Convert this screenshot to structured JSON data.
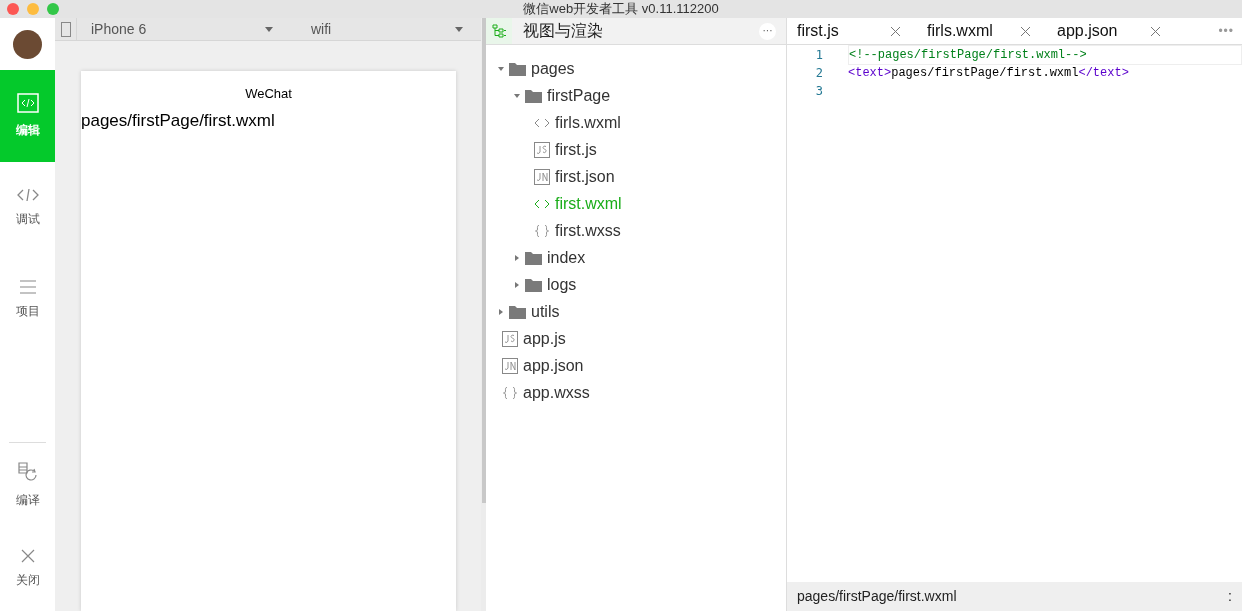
{
  "window": {
    "title": "微信web开发者工具 v0.11.112200"
  },
  "sidebar": {
    "items": [
      {
        "kind": "edit",
        "label": "编辑",
        "selected": true
      },
      {
        "kind": "debug",
        "label": "调试",
        "selected": false
      },
      {
        "kind": "project",
        "label": "项目",
        "selected": false
      }
    ],
    "bottom_items": [
      {
        "kind": "compile",
        "label": "编译"
      },
      {
        "kind": "close",
        "label": "关闭"
      }
    ]
  },
  "simulator": {
    "device": "iPhone 6",
    "network": "wifi",
    "nav_title": "WeChat",
    "page_text": "pages/firstPage/first.wxml"
  },
  "file_tree": {
    "title": "视图与渲染",
    "more": "···",
    "items": [
      {
        "kind": "folder",
        "name": "pages",
        "expanded": true,
        "children": [
          {
            "kind": "folder",
            "name": "firstPage",
            "expanded": true,
            "children": [
              {
                "kind": "wxml",
                "name": "firls.wxml",
                "selected": false
              },
              {
                "kind": "js",
                "name": "first.js",
                "selected": false
              },
              {
                "kind": "json",
                "name": "first.json",
                "selected": false
              },
              {
                "kind": "wxml",
                "name": "first.wxml",
                "selected": true
              },
              {
                "kind": "wxss",
                "name": "first.wxss",
                "selected": false
              }
            ]
          },
          {
            "kind": "folder",
            "name": "index",
            "expanded": false
          },
          {
            "kind": "folder",
            "name": "logs",
            "expanded": false
          }
        ]
      },
      {
        "kind": "folder",
        "name": "utils",
        "expanded": false
      },
      {
        "kind": "js",
        "name": "app.js",
        "selected": false
      },
      {
        "kind": "json",
        "name": "app.json",
        "selected": false
      },
      {
        "kind": "wxss",
        "name": "app.wxss",
        "selected": false
      }
    ]
  },
  "editor": {
    "tabs": [
      {
        "label": "first.js"
      },
      {
        "label": "firls.wxml"
      },
      {
        "label": "app.json"
      }
    ],
    "more": "•••",
    "lines": [
      {
        "number": "1",
        "tokens": [
          {
            "kind": "comment",
            "text": "<!--pages/firstPage/first.wxml-->"
          }
        ]
      },
      {
        "number": "2",
        "tokens": [
          {
            "kind": "tag",
            "text": "<text>"
          },
          {
            "kind": "text",
            "text": "pages/firstPage/first.wxml"
          },
          {
            "kind": "tag",
            "text": "</text>"
          }
        ]
      },
      {
        "number": "3"
      }
    ],
    "status_bar": {
      "path": "pages/firstPage/first.wxml",
      "position": ":"
    }
  }
}
